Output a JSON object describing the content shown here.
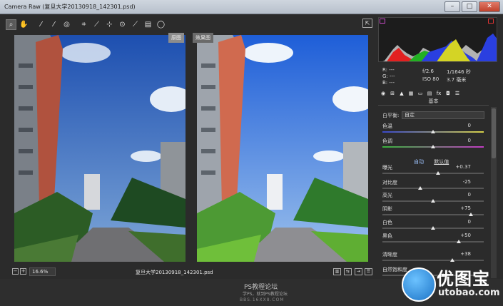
{
  "window": {
    "title": "Camera Raw (复旦大学20130918_142301.psd)"
  },
  "toolbar": {
    "tools": [
      "zoom-icon",
      "hand-icon",
      "white-balance-icon",
      "color-sampler-icon",
      "target-adjust-icon",
      "crop-icon",
      "straighten-icon",
      "spot-removal-icon",
      "red-eye-icon",
      "adjustment-brush-icon",
      "graduated-filter-icon",
      "radial-filter-icon"
    ]
  },
  "view_tabs": {
    "before": "原图",
    "after": "效果图"
  },
  "preview": {
    "zoom": "16.6%",
    "filename": "复旦大学20130918_142301.psd"
  },
  "readout": {
    "r": "R:  ---",
    "g": "G:  ---",
    "b": "B:  ---",
    "aperture": "f/2.6",
    "shutter": "1/1646 秒",
    "iso": "ISO 80",
    "focal": "3.7 毫米"
  },
  "panel": {
    "title": "基本",
    "wb_label": "白平衡:",
    "wb_value": "自定",
    "auto": "自动",
    "default": "默认值"
  },
  "sliders": [
    {
      "name": "色温",
      "value": "0",
      "pos": 0.5,
      "kind": "temp"
    },
    {
      "name": "色调",
      "value": "0",
      "pos": 0.5,
      "kind": "tint"
    },
    {
      "name": "曝光",
      "value": "+0.37",
      "pos": 0.55,
      "kind": "plain"
    },
    {
      "name": "对比度",
      "value": "-25",
      "pos": 0.375,
      "kind": "plain"
    },
    {
      "name": "高光",
      "value": "0",
      "pos": 0.5,
      "kind": "plain"
    },
    {
      "name": "阴影",
      "value": "+75",
      "pos": 0.875,
      "kind": "plain"
    },
    {
      "name": "白色",
      "value": "0",
      "pos": 0.5,
      "kind": "plain"
    },
    {
      "name": "黑色",
      "value": "+50",
      "pos": 0.75,
      "kind": "plain"
    },
    {
      "name": "清晰度",
      "value": "+38",
      "pos": 0.69,
      "kind": "plain"
    },
    {
      "name": "自然饱和度",
      "value": "",
      "pos": 0.6,
      "kind": "plain"
    }
  ],
  "watermark": {
    "title": "PS教程论坛",
    "subtitle": "学PS，就到PS教程论坛",
    "url": "BBS.16XX8.COM"
  },
  "logo": {
    "name": "优图宝",
    "url": "utobao.com"
  },
  "colors": {
    "panel_bg": "#2b2b2b",
    "sky_before": "#2f69c9",
    "sky_after": "#2f6fe0",
    "grass": "#3aa62e"
  }
}
